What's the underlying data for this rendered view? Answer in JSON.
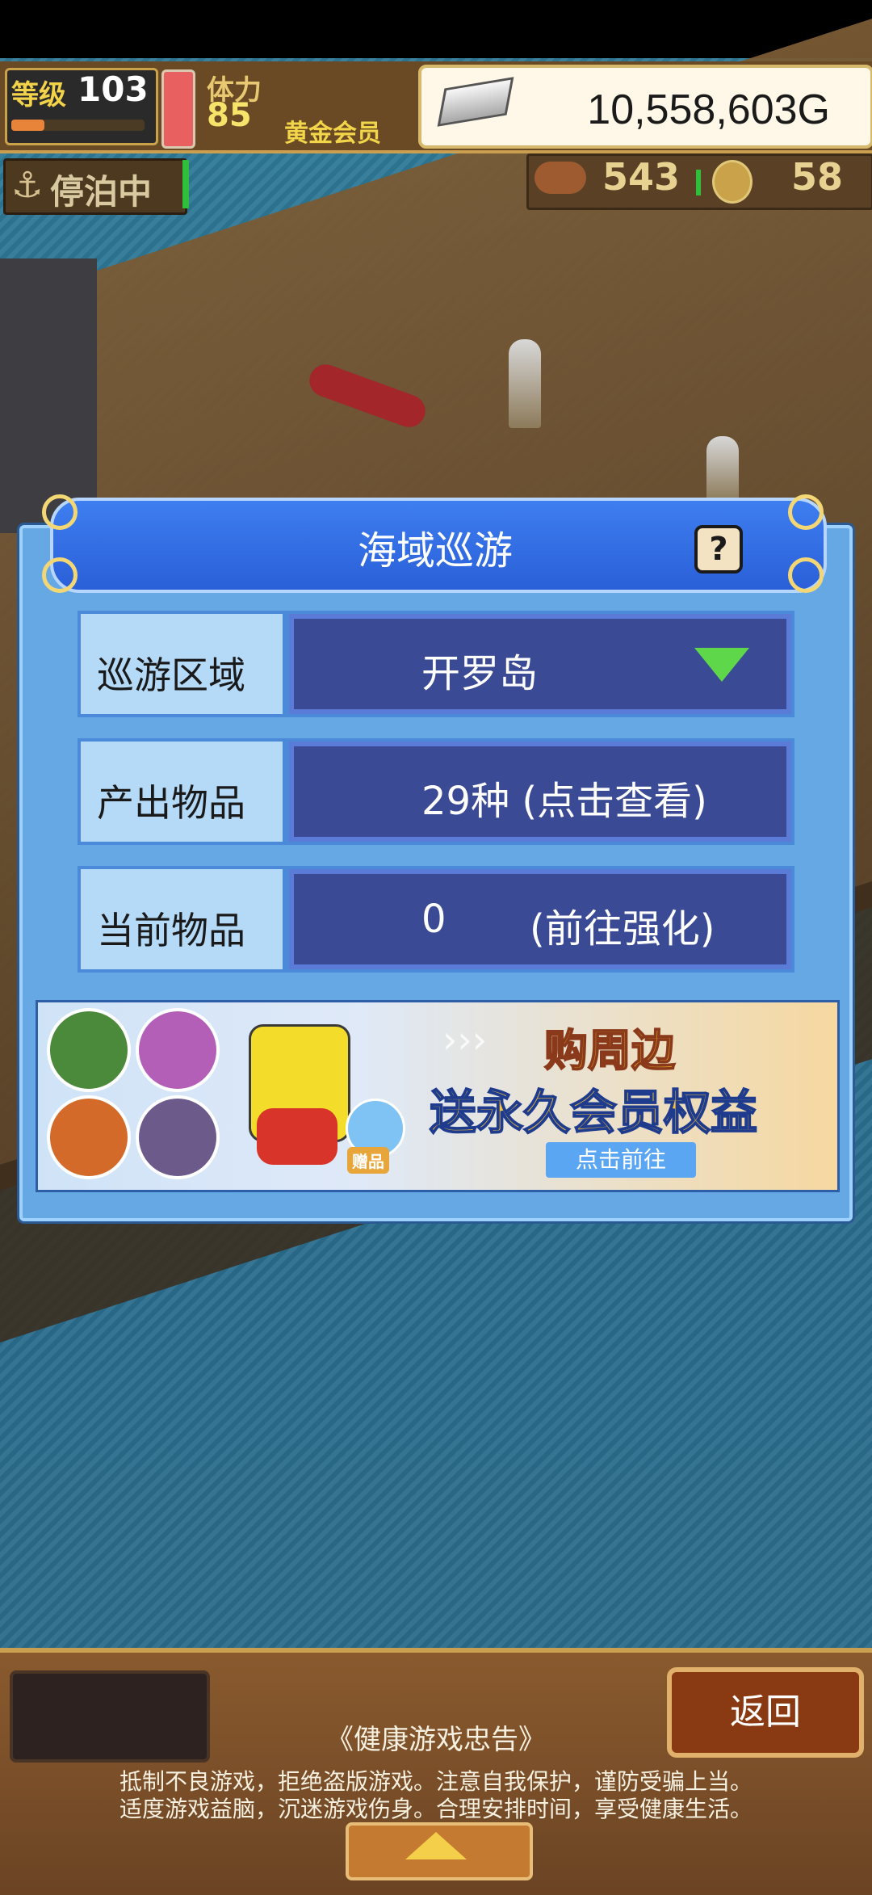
{
  "hud": {
    "level_label": "等级",
    "level_value": "103",
    "exp_progress": 0.25,
    "stamina_label": "体力",
    "stamina_value": "85",
    "member_label": "黄金会员",
    "gold_value": "10,558,603G",
    "dock_label": "停泊中",
    "food_value": "543",
    "coin_value": "58"
  },
  "dialog": {
    "title": "海域巡游",
    "help_symbol": "?",
    "rows": [
      {
        "label": "巡游区域",
        "value": "开罗岛"
      },
      {
        "label": "产出物品",
        "value": "29种 (点击查看)"
      },
      {
        "label": "当前物品",
        "value": "0",
        "action": "(前往强化)"
      }
    ]
  },
  "promo": {
    "line1": "购周边",
    "line2": "送永久会员权益",
    "button": "点击前往",
    "gift_label": "赠品",
    "arrows": "›››"
  },
  "bottom": {
    "back_label": "返回",
    "notice_title": "《健康游戏忠告》",
    "notice_line1": "抵制不良游戏，拒绝盗版游戏。注意自我保护，谨防受骗上当。",
    "notice_line2": "适度游戏益脑，沉迷游戏伤身。合理安排时间，享受健康生活。"
  },
  "colors": {
    "dialog_bg": "#66a8e4",
    "header_blue": "#2a5fd8",
    "field_bg": "#3a4a95",
    "accent_green": "#5ed84a"
  }
}
